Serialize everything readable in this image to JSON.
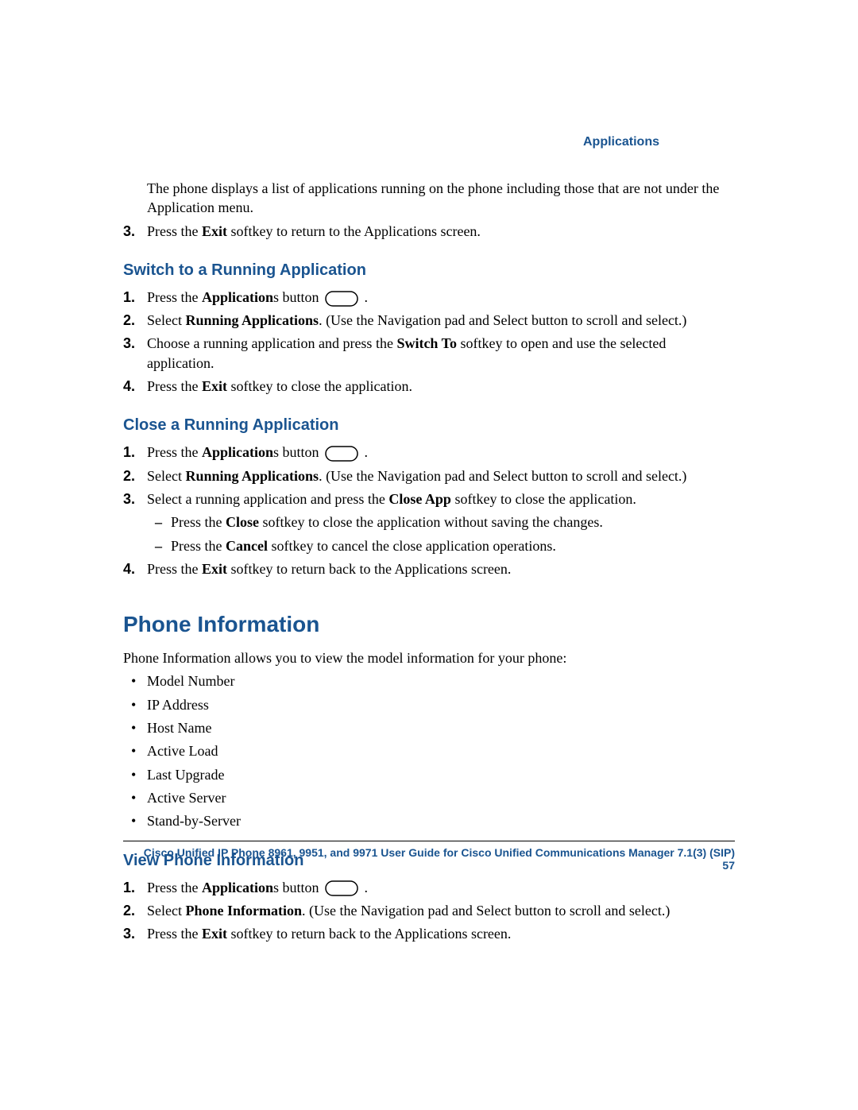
{
  "header": {
    "label": "Applications"
  },
  "intro": {
    "p1": "The phone displays a list of applications running on the phone including those that are not under the Application menu.",
    "step3_a": "Press the ",
    "step3_b": "Exit",
    "step3_c": " softkey to return to the Applications screen."
  },
  "switch": {
    "title": "Switch to a Running Application",
    "s1_a": "Press the ",
    "s1_b": "Application",
    "s1_c": "s button ",
    "s1_d": " .",
    "s2_a": "Select ",
    "s2_b": "Running Applications",
    "s2_c": ". (Use the Navigation pad and Select button to scroll and select.)",
    "s3_a": "Choose a running application and press the ",
    "s3_b": "Switch To",
    "s3_c": " softkey to open and use the selected application.",
    "s4_a": "Press the ",
    "s4_b": "Exit",
    "s4_c": " softkey to close the application."
  },
  "close": {
    "title": "Close a Running Application",
    "s1_a": "Press the ",
    "s1_b": "Application",
    "s1_c": "s button ",
    "s1_d": " .",
    "s2_a": "Select ",
    "s2_b": "Running Applications",
    "s2_c": ". (Use the Navigation pad and Select button to scroll and select.)",
    "s3_a": "Select a running application and press the ",
    "s3_b": "Close App",
    "s3_c": " softkey to close the application.",
    "s3_sub1_a": "Press the ",
    "s3_sub1_b": "Close",
    "s3_sub1_c": " softkey to close the application without saving the changes.",
    "s3_sub2_a": "Press the ",
    "s3_sub2_b": "Cancel",
    "s3_sub2_c": " softkey to cancel the close application operations.",
    "s4_a": "Press the ",
    "s4_b": "Exit",
    "s4_c": " softkey to return back to the Applications screen."
  },
  "phone_info": {
    "title": "Phone Information",
    "intro": "Phone Information allows you to view the model information for your phone:",
    "items": {
      "i1": "Model Number",
      "i2": "IP Address",
      "i3": "Host Name",
      "i4": "Active Load",
      "i5": "Last Upgrade",
      "i6": "Active Server",
      "i7": "Stand-by-Server"
    }
  },
  "view_phone": {
    "title": "View Phone Information",
    "s1_a": "Press the ",
    "s1_b": "Application",
    "s1_c": "s button ",
    "s1_d": " .",
    "s2_a": "Select ",
    "s2_b": "Phone Information",
    "s2_c": ". (Use the Navigation pad and Select button to scroll and select.)",
    "s3_a": "Press the ",
    "s3_b": "Exit",
    "s3_c": " softkey to return back to the Applications screen."
  },
  "footer": {
    "title": "Cisco Unified IP Phone 8961, 9951, and 9971 User Guide for Cisco Unified Communications Manager 7.1(3) (SIP)",
    "page": "57"
  }
}
